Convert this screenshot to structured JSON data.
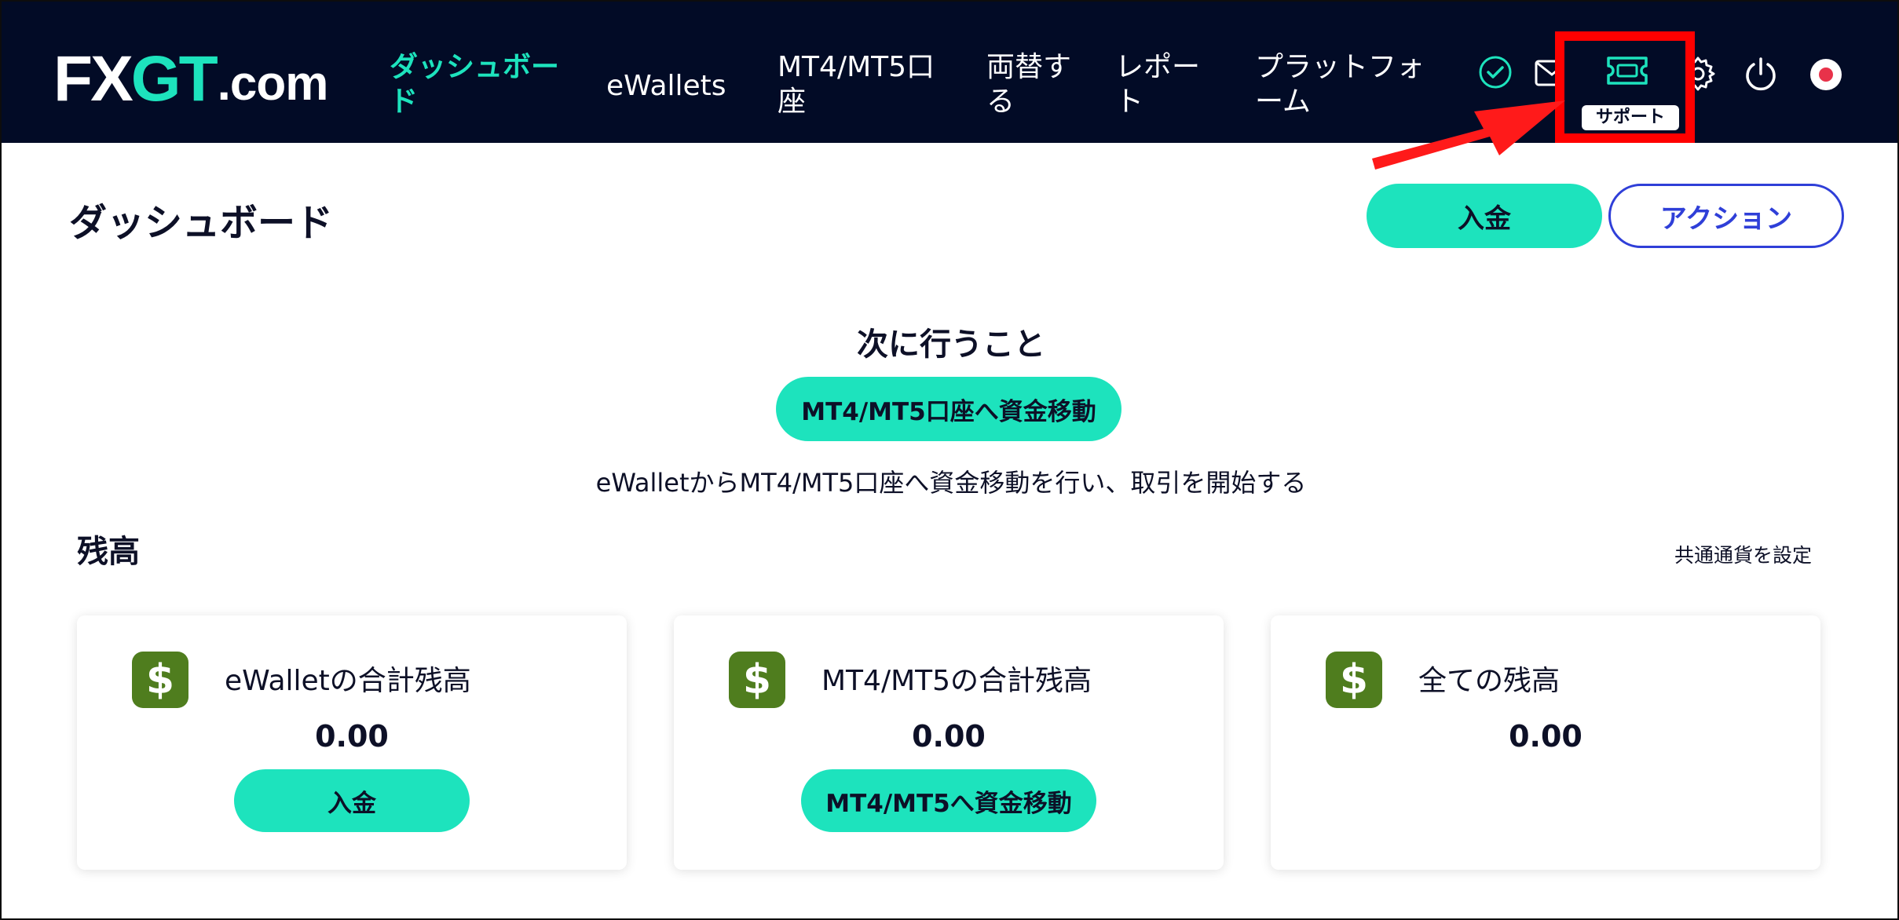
{
  "brand": {
    "logo_fx": "FX",
    "logo_gt": "GT",
    "logo_com": ".com",
    "accent": "#1de3bd",
    "navbar_bg": "#020b26"
  },
  "nav": {
    "dashboard_line1": "ダッシュボー",
    "dashboard_line2": "ド",
    "ewallets": "eWallets",
    "accounts_line1": "MT4/MT5口",
    "accounts_line2": "座",
    "exchange_line1": "両替す",
    "exchange_line2": "る",
    "report_line1": "レポー",
    "report_line2": "ト",
    "platform_line1": "プラットフォ",
    "platform_line2": "ーム"
  },
  "toolbar": {
    "icons": [
      "verified-check-icon",
      "mail-icon",
      "ticket-icon",
      "gear-icon",
      "power-icon",
      "flag-japan-icon"
    ],
    "support_tooltip": "サポート",
    "highlight_color": "#ff0000"
  },
  "header": {
    "title": "ダッシュボード",
    "deposit_label": "入金",
    "action_label": "アクション"
  },
  "next_steps": {
    "title": "次に行うこと",
    "button_label": "MT4/MT5口座へ資金移動",
    "description": "eWalletからMT4/MT5口座へ資金移動を行い、取引を開始する"
  },
  "balance": {
    "title": "残高",
    "set_currency_link": "共通通貨を設定",
    "cards": [
      {
        "icon": "$",
        "label": "eWalletの合計残高",
        "amount": "0.00",
        "button": "入金"
      },
      {
        "icon": "$",
        "label": "MT4/MT5の合計残高",
        "amount": "0.00",
        "button": "MT4/MT5へ資金移動"
      },
      {
        "icon": "$",
        "label": "全ての残高",
        "amount": "0.00"
      }
    ]
  }
}
